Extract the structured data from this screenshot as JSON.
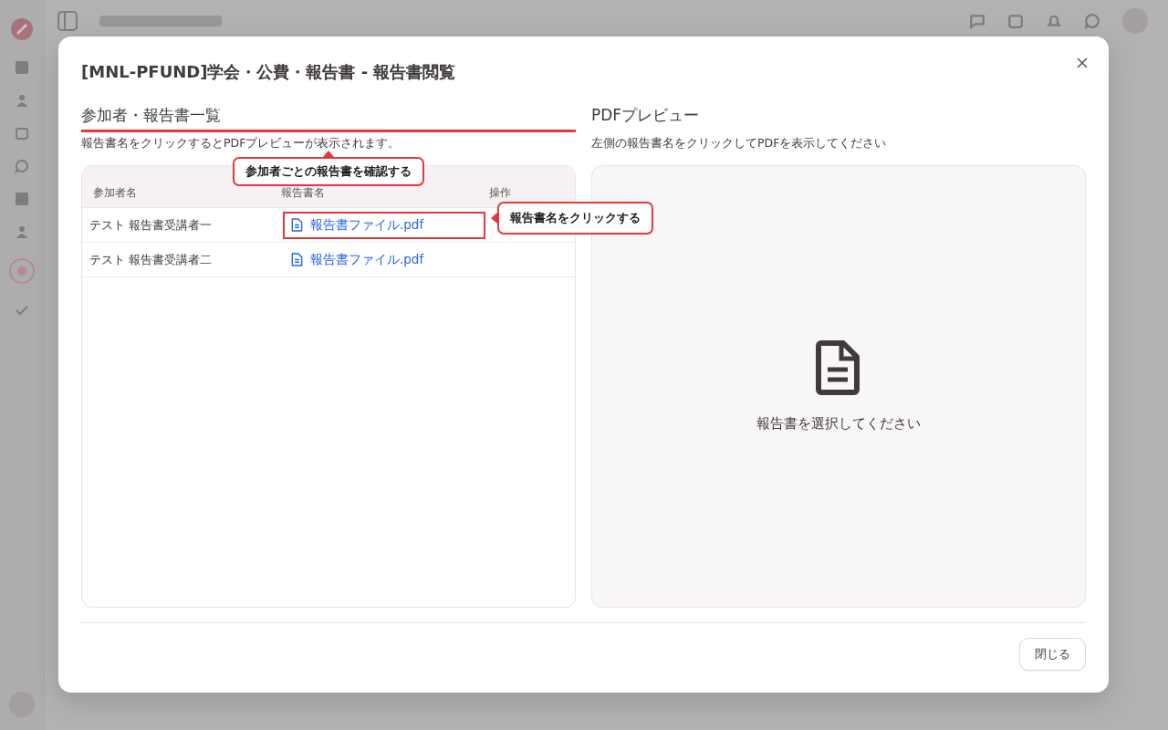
{
  "dialog": {
    "title": "[MNL-PFUND]学会・公費・報告書 - 報告書閲覧"
  },
  "left": {
    "heading": "参加者・報告書一覧",
    "hint": "報告書名をクリックするとPDFプレビューが表示されます。",
    "columns": [
      "参加者名",
      "報告書名",
      "操作"
    ],
    "rows": [
      {
        "participant": "テスト 報告書受講者一",
        "file": "報告書ファイル.pdf",
        "highlighted": true
      },
      {
        "participant": "テスト 報告書受講者二",
        "file": "報告書ファイル.pdf",
        "highlighted": false
      }
    ]
  },
  "right": {
    "heading": "PDFプレビュー",
    "hint": "左側の報告書名をクリックしてPDFを表示してください",
    "empty_message": "報告書を選択してください"
  },
  "callouts": [
    {
      "text": "参加者ごとの報告書を確認する",
      "kind": "up"
    },
    {
      "text": "報告書名をクリックする",
      "kind": "left"
    }
  ],
  "buttons": [
    "閉じる"
  ]
}
